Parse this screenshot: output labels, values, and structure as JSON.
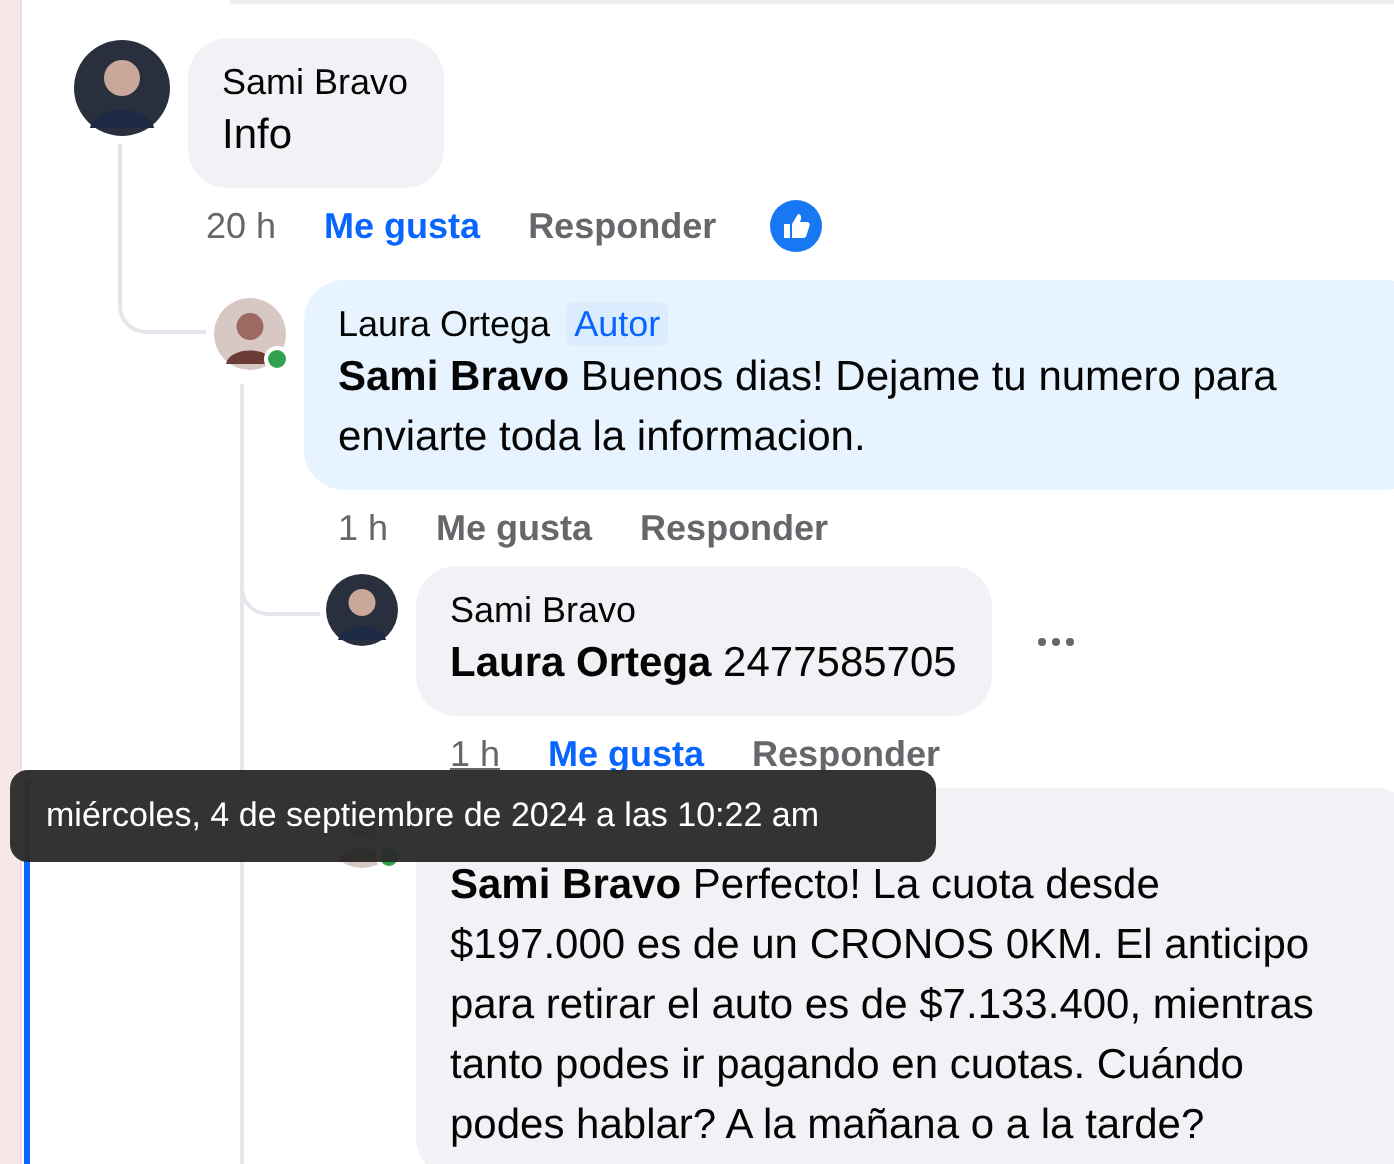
{
  "comments": [
    {
      "author": "Sami Bravo",
      "text": "Info",
      "online": false,
      "highlighted": false,
      "hovered": false,
      "liked": true,
      "reacted": true,
      "time": "20 h",
      "like": "Me gusta",
      "reply": "Responder",
      "children": [
        {
          "author": "Laura Ortega",
          "badge": "Autor",
          "text": "**Sami Bravo** Buenos dias! Dejame tu numero para enviarte toda la informacion.",
          "online": true,
          "highlighted": true,
          "hovered": false,
          "liked": false,
          "reacted": false,
          "time": "1 h",
          "like": "Me gusta",
          "reply": "Responder",
          "children": [
            {
              "author": "Sami Bravo",
              "text": "**Laura Ortega** 2477585705",
              "online": false,
              "highlighted": false,
              "hovered": true,
              "liked": true,
              "reacted": false,
              "time": "1 h",
              "like": "Me gusta",
              "reply": "Responder"
            },
            {
              "text": "**Sami Bravo** Perfecto! La cuota desde $197.000 es de un CRONOS 0KM. El anticipo para retirar el auto es de $7.133.400, mientras tanto podes ir pagando en cuotas. Cuándo podes hablar? A la mañana o a la tarde?",
              "online": true,
              "highlighted": false
            }
          ]
        }
      ]
    }
  ],
  "tooltip": {
    "text": "miércoles, 4 de septiembre de 2024 a las 10:22 am"
  }
}
